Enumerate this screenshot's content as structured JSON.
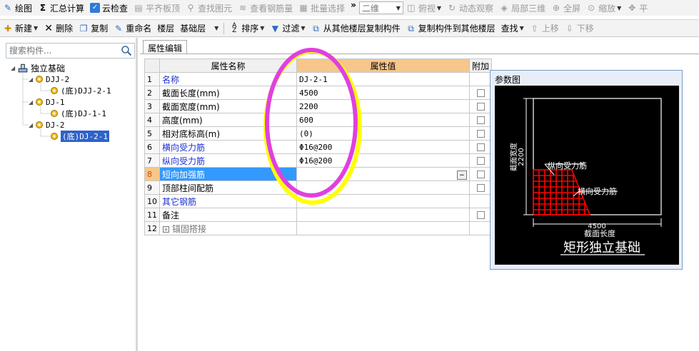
{
  "toolbar_top": {
    "items": [
      {
        "label": "绘图",
        "icon": "draw-icon",
        "disabled": false
      },
      {
        "label": "汇总计算",
        "icon": "sigma-icon",
        "disabled": false
      },
      {
        "label": "云检查",
        "icon": "cloud-check-icon",
        "disabled": false
      },
      {
        "label": "平齐板顶",
        "icon": "align-top-icon",
        "disabled": true
      },
      {
        "label": "查找图元",
        "icon": "find-element-icon",
        "disabled": true
      },
      {
        "label": "查看钢筋量",
        "icon": "rebar-icon",
        "disabled": true
      },
      {
        "label": "批量选择",
        "icon": "batch-select-icon",
        "disabled": true
      }
    ],
    "overflow": "»",
    "view_mode": "二维",
    "view_items": [
      {
        "label": "俯视",
        "icon": "top-view-icon"
      },
      {
        "label": "动态观察",
        "icon": "orbit-icon"
      },
      {
        "label": "局部三维",
        "icon": "local-3d-icon"
      },
      {
        "label": "全屏",
        "icon": "fullscreen-icon"
      },
      {
        "label": "缩放",
        "icon": "zoom-icon"
      },
      {
        "label": "平",
        "icon": "pan-icon"
      }
    ]
  },
  "toolbar_second": {
    "new_label": "新建",
    "delete_label": "删除",
    "copy_label": "复制",
    "rename_label": "重命名",
    "floor_label": "楼层",
    "floor_value": "基础层",
    "sort_label": "排序",
    "filter_label": "过滤",
    "copy_from_label": "从其他楼层复制构件",
    "copy_to_label": "复制构件到其他楼层",
    "find_label": "查找",
    "move_up_label": "上移",
    "move_down_label": "下移"
  },
  "left_panel": {
    "search_placeholder": "搜索构件...",
    "tree": {
      "root": "独立基础",
      "nodes": [
        {
          "label": "DJJ-2",
          "child": "(底)DJJ-2-1"
        },
        {
          "label": "DJ-1",
          "child": "(底)DJ-1-1"
        },
        {
          "label": "DJ-2",
          "child": "(底)DJ-2-1"
        }
      ]
    }
  },
  "tab": {
    "label": "属性编辑"
  },
  "grid": {
    "headers": {
      "name": "属性名称",
      "value": "属性值",
      "extra": "附加"
    },
    "rows": [
      {
        "num": "1",
        "name": "名称",
        "value": "DJ-2-1",
        "style": "blue",
        "checkbox": false
      },
      {
        "num": "2",
        "name": "截面长度(mm)",
        "value": "4500",
        "style": "normal",
        "checkbox": true
      },
      {
        "num": "3",
        "name": "截面宽度(mm)",
        "value": "2200",
        "style": "normal",
        "checkbox": true
      },
      {
        "num": "4",
        "name": "高度(mm)",
        "value": "600",
        "style": "normal",
        "checkbox": true
      },
      {
        "num": "5",
        "name": "相对底标高(m)",
        "value": "(0)",
        "style": "normal",
        "checkbox": true
      },
      {
        "num": "6",
        "name": "横向受力筋",
        "value": "Φ16@200",
        "style": "blue",
        "checkbox": true
      },
      {
        "num": "7",
        "name": "纵向受力筋",
        "value": "Φ16@200",
        "style": "blue",
        "checkbox": true
      },
      {
        "num": "8",
        "name": "短向加强筋",
        "value": "",
        "style": "selected",
        "checkbox": true,
        "ellipsis": "…"
      },
      {
        "num": "9",
        "name": "顶部柱间配筋",
        "value": "",
        "style": "normal",
        "checkbox": true
      },
      {
        "num": "10",
        "name": "其它钢筋",
        "value": "",
        "style": "blue",
        "checkbox": false
      },
      {
        "num": "11",
        "name": "备注",
        "value": "",
        "style": "normal",
        "checkbox": true
      },
      {
        "num": "12",
        "name": "锚固搭接",
        "value": "",
        "style": "gray",
        "checkbox": false,
        "expander": "+"
      }
    ]
  },
  "param_window": {
    "title": "参数图",
    "width_dim": "2200",
    "width_label": "截面宽度",
    "long_rebar_label": "纵向受力筋",
    "trans_rebar_label": "横向受力筋",
    "length_dim": "4500",
    "length_label": "截面长度",
    "caption": "矩形独立基础"
  },
  "colors": {
    "selection_blue": "#3399ff",
    "tree_selection": "#2f62c9",
    "header_orange": "#f6c68b",
    "link_blue": "#1c2fd0",
    "annotation_magenta": "#e040e0",
    "annotation_yellow": "#ffff00",
    "rebar_red": "#ff0000"
  }
}
